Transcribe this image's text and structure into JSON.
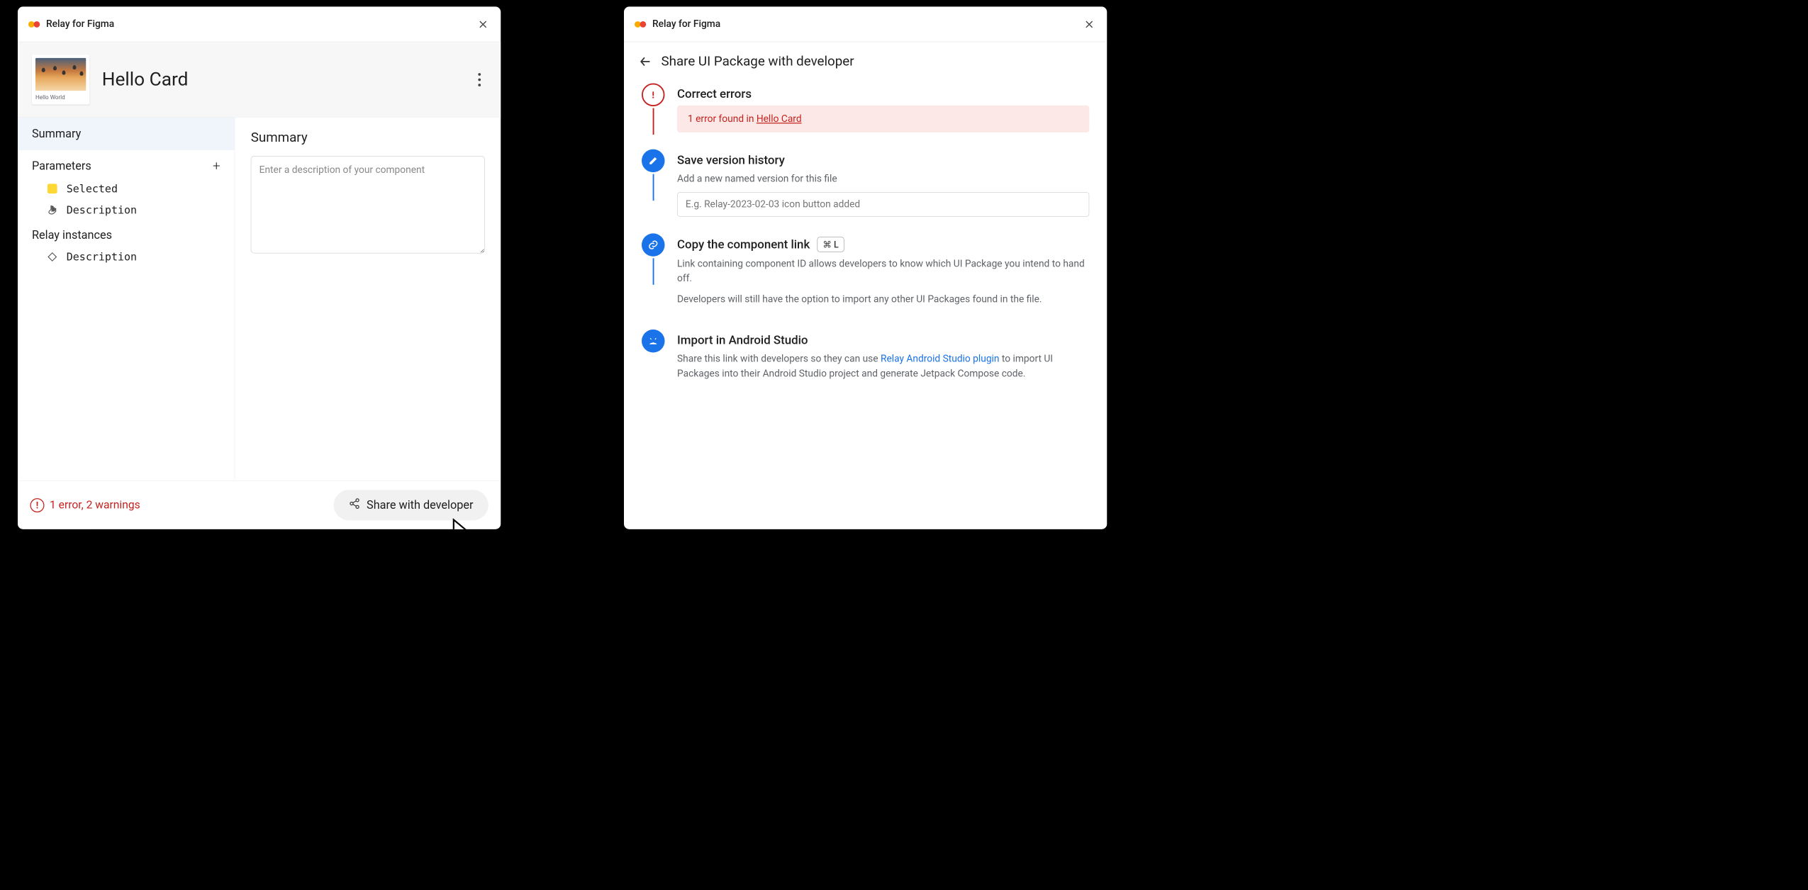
{
  "app_title": "Relay for Figma",
  "left": {
    "card": {
      "thumb_label": "Hello World",
      "title": "Hello Card"
    },
    "sidebar": {
      "summary_tab": "Summary",
      "parameters_header": "Parameters",
      "param_items": [
        "Selected",
        "Description"
      ],
      "instances_header": "Relay instances",
      "instance_items": [
        "Description"
      ]
    },
    "main": {
      "heading": "Summary",
      "placeholder": "Enter a description of your component"
    },
    "footer": {
      "error_text": "1 error, 2 warnings",
      "share_label": "Share with developer"
    }
  },
  "right": {
    "header": "Share UI Package with developer",
    "steps": {
      "errors": {
        "title": "Correct errors",
        "banner_prefix": "1 error found in ",
        "banner_link": "Hello Card"
      },
      "version": {
        "title": "Save version history",
        "subtitle": "Add a new named version for this file",
        "placeholder": "E.g. Relay-2023-02-03 icon button added"
      },
      "copy": {
        "title": "Copy the component link",
        "shortcut": "⌘ L",
        "sub1": "Link containing component ID allows developers to know which UI Package you intend to hand off.",
        "sub2": "Developers will still have the option to import any other UI Packages found in the file."
      },
      "import": {
        "title": "Import in Android Studio",
        "sub_prefix": "Share this link with developers so they can use ",
        "sub_link": "Relay Android Studio plugin",
        "sub_suffix": " to import UI Packages into their Android Studio project and generate Jetpack Compose code."
      }
    }
  }
}
